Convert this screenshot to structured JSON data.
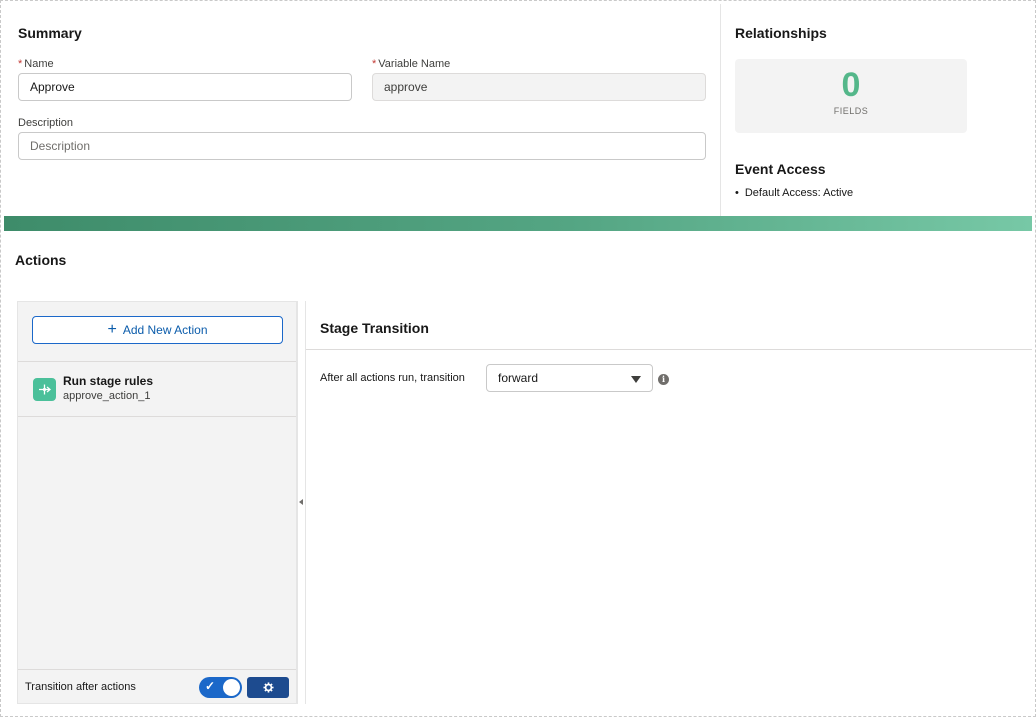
{
  "summary": {
    "title": "Summary",
    "name_label": "Name",
    "name_value": "Approve",
    "variable_label": "Variable Name",
    "variable_value": "approve",
    "description_label": "Description",
    "description_placeholder": "Description",
    "required_mark": "*"
  },
  "relationships": {
    "title": "Relationships",
    "fields_count": "0",
    "fields_label": "FIELDS"
  },
  "event_access": {
    "title": "Event Access",
    "items": [
      "Default Access: Active"
    ]
  },
  "actions": {
    "title": "Actions",
    "add_button": "Add New Action",
    "items": [
      {
        "title": "Run stage rules",
        "subtitle": "approve_action_1",
        "icon": "stage-rules-icon"
      }
    ],
    "footer_label": "Transition after actions",
    "toggle_checked": true
  },
  "stage_transition": {
    "title": "Stage Transition",
    "label": "After all actions run, transition",
    "selected": "forward",
    "info_icon": "i"
  },
  "colors": {
    "accent_green": "#54b78a",
    "brand_blue": "#1b68c9",
    "dark_blue": "#1d4b8f",
    "action_icon_bg": "#4bc09a"
  }
}
